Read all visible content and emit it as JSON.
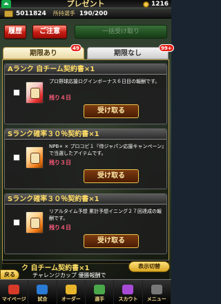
{
  "header": {
    "title": "プレゼント",
    "coins": "1216"
  },
  "status": {
    "money": "5011824",
    "players_label": "所持選手",
    "players_count": "190/200"
  },
  "buttons": {
    "history": "履歴",
    "notice": "ご注意",
    "collect_all": "一括受け取り"
  },
  "tabs": [
    {
      "label": "期限あり",
      "badge": "49"
    },
    {
      "label": "期限なし",
      "badge": "99+"
    }
  ],
  "cards": [
    {
      "title": "Aランク 自チーム契約書×1",
      "description": "プロ野球応援ログインボーナス６日目の報酬です。",
      "remaining": "残り４日",
      "receive": "受け取る"
    },
    {
      "title": "Sランク確率３０％契約書×1",
      "description": "NPB+ × プロコビ１『侍ジャパン応援キャンペーン』で当選したアイテムです。",
      "remaining": "残り３日",
      "receive": "受け取る"
    },
    {
      "title": "Sランク確率３０％契約書×1",
      "description": "リアルタイム予想 累計予想イニング２７回達成の報酬です。",
      "remaining": "残り４日",
      "receive": "受け取る"
    }
  ],
  "footer_card": {
    "title": "ク 自チーム契約書×1",
    "description": "チャレンジカップ 優勝報酬で"
  },
  "toggle_display": "表示切替",
  "back": "戻る",
  "nav": [
    {
      "label": "マイページ"
    },
    {
      "label": "試合"
    },
    {
      "label": "オーダー"
    },
    {
      "label": "選手"
    },
    {
      "label": "スカウト"
    },
    {
      "label": "メニュー"
    }
  ]
}
